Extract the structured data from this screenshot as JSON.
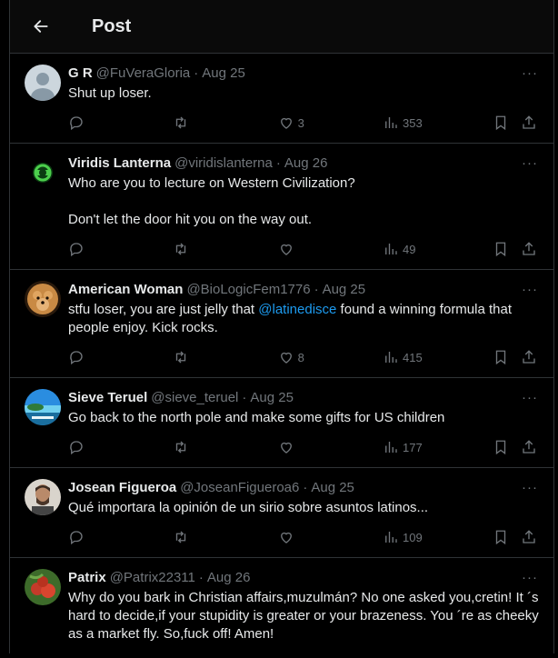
{
  "header": {
    "title": "Post"
  },
  "replies": [
    {
      "name": "G R",
      "handle": "@FuVeraGloria",
      "date": "Aug 25",
      "text": "Shut up loser.",
      "likes": "3",
      "views": "353"
    },
    {
      "name": "Viridis Lanterna",
      "handle": "@viridislanterna",
      "date": "Aug 26",
      "text": "Who are you to lecture on Western Civilization?\n\nDon't let the door hit you on the way out.",
      "likes": "",
      "views": "49"
    },
    {
      "name": "American Woman",
      "handle": "@BioLogicFem1776",
      "date": "Aug 25",
      "text_before": "stfu loser, you are just jelly that ",
      "mention": "@latinedisce",
      "text_after": " found a winning formula that people enjoy. Kick rocks.",
      "likes": "8",
      "views": "415"
    },
    {
      "name": "Sieve Teruel",
      "handle": "@sieve_teruel",
      "date": "Aug 25",
      "text": "Go back to the north pole and make some gifts for US children",
      "likes": "",
      "views": "177"
    },
    {
      "name": "Josean Figueroa",
      "handle": "@JoseanFigueroa6",
      "date": "Aug 25",
      "text": "Qué importara la opinión de un sirio sobre asuntos latinos...",
      "likes": "",
      "views": "109"
    },
    {
      "name": "Patrix",
      "handle": "@Patrix22311",
      "date": "Aug 26",
      "text": "Why do you bark in Christian affairs,muzulmán? No one asked you,cretin! It ´s hard to decide,if your stupidity is greater or your brazeness. You ´re as cheeky as a market fly. So,fuck off! Amen!",
      "likes": "",
      "views": ""
    }
  ],
  "separator": "·",
  "more": "···",
  "colors": {
    "accent": "#1d9bf0",
    "muted": "#71767b",
    "text": "#e7e9ea",
    "border": "#2f3336"
  }
}
